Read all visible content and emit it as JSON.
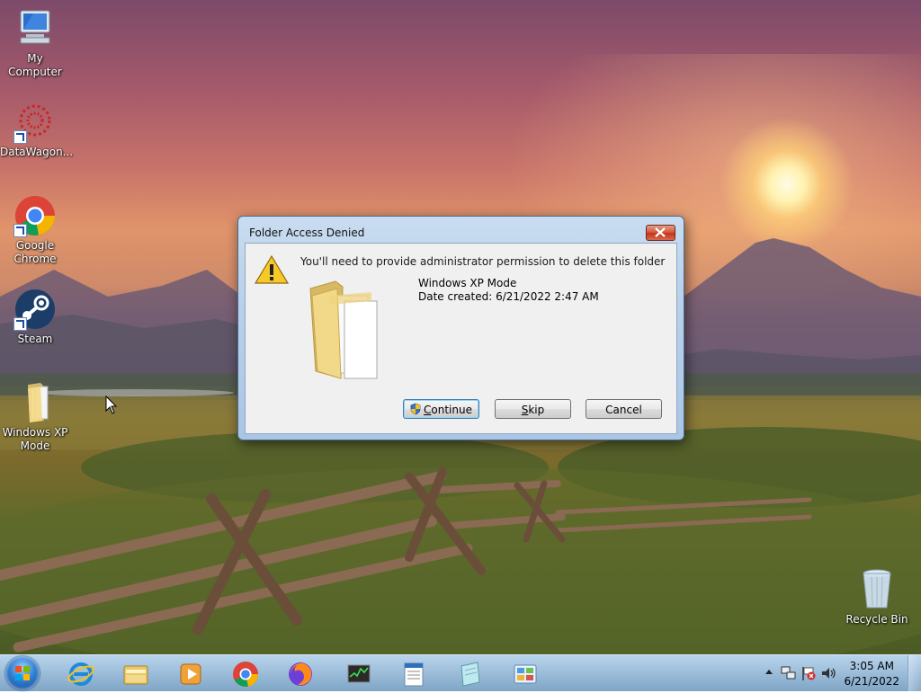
{
  "desktop_icons": [
    {
      "id": "my-computer",
      "label": "My Computer",
      "icon": "computer-icon"
    },
    {
      "id": "datawagon",
      "label": "DataWagon...",
      "icon": "datawagon-icon"
    },
    {
      "id": "google-chrome",
      "label": "Google Chrome",
      "icon": "chrome-icon"
    },
    {
      "id": "steam",
      "label": "Steam",
      "icon": "steam-icon"
    },
    {
      "id": "windows-xp-mode",
      "label": "Windows XP Mode",
      "icon": "folder-icon"
    },
    {
      "id": "recycle-bin",
      "label": "Recycle Bin",
      "icon": "recycle-bin-icon"
    }
  ],
  "dialog": {
    "title": "Folder Access Denied",
    "message": "You'll need to provide administrator permission to delete this folder",
    "item_name": "Windows XP Mode",
    "item_date": "Date created: 6/21/2022 2:47 AM",
    "buttons": {
      "continue_first": "C",
      "continue_rest": "ontinue",
      "skip_first": "S",
      "skip_rest": "kip",
      "cancel": "Cancel"
    }
  },
  "taskbar": {
    "pinned": [
      "internet-explorer-icon",
      "file-explorer-icon",
      "media-player-icon",
      "chrome-icon",
      "firefox-icon",
      "task-manager-icon",
      "wordpad-icon",
      "notepad-icon",
      "control-panel-icon"
    ],
    "tray": {
      "time": "3:05 AM",
      "date": "6/21/2022",
      "icons": [
        "show-hidden-icons-icon",
        "network-icon",
        "action-center-flag-icon",
        "volume-icon"
      ]
    }
  },
  "colors": {
    "title_bar": "#b8d0ea",
    "close_button": "#c3331a",
    "taskbar": "#96b9d7",
    "dialog_body": "#f0f0f0"
  }
}
